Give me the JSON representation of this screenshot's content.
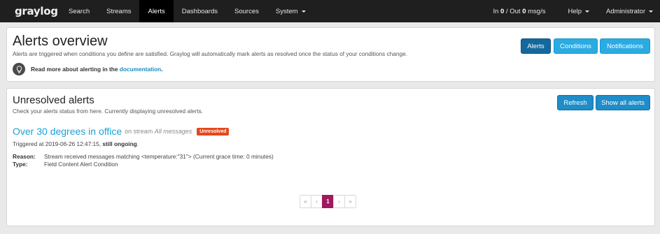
{
  "navbar": {
    "logo": "graylog",
    "items": [
      {
        "label": "Search"
      },
      {
        "label": "Streams"
      },
      {
        "label": "Alerts"
      },
      {
        "label": "Dashboards"
      },
      {
        "label": "Sources"
      },
      {
        "label": "System"
      }
    ],
    "throughput": {
      "prefix": "In ",
      "in_value": "0",
      "mid": " / Out ",
      "out_value": "0",
      "suffix": " msg/s"
    },
    "help": "Help",
    "user": "Administrator"
  },
  "overview": {
    "title": "Alerts overview",
    "description": "Alerts are triggered when conditions you define are satisfied. Graylog will automatically mark alerts as resolved once the status of your conditions change.",
    "doc_prefix": "Read more about alerting in the ",
    "doc_link": "documentation",
    "doc_suffix": ".",
    "buttons": {
      "alerts": "Alerts",
      "conditions": "Conditions",
      "notifications": "Notifications"
    }
  },
  "unresolved": {
    "title": "Unresolved alerts",
    "description": "Check your alerts status from here. Currently displaying unresolved alerts.",
    "buttons": {
      "refresh": "Refresh",
      "show_all": "Show all alerts"
    },
    "alert": {
      "name": "Over 30 degrees in office",
      "on_stream": "on stream",
      "stream": "All messages",
      "badge": "Unresolved",
      "triggered_prefix": "Triggered at 2019-06-26 12:47:15, ",
      "triggered_state": "still ongoing",
      "triggered_suffix": ".",
      "reason_label": "Reason:",
      "reason_value": "Stream received messages matching <temperature:\"31\"> (Current grace time: 0 minutes)",
      "type_label": "Type:",
      "type_value": "Field Content Alert Condition"
    },
    "pagination": [
      "«",
      "‹",
      "1",
      "›",
      "»"
    ]
  },
  "colors": {
    "accent": "#1ba2d8",
    "badge": "#e4481c",
    "page_current": "#a0195f",
    "navbar": "#1f1f1f"
  }
}
